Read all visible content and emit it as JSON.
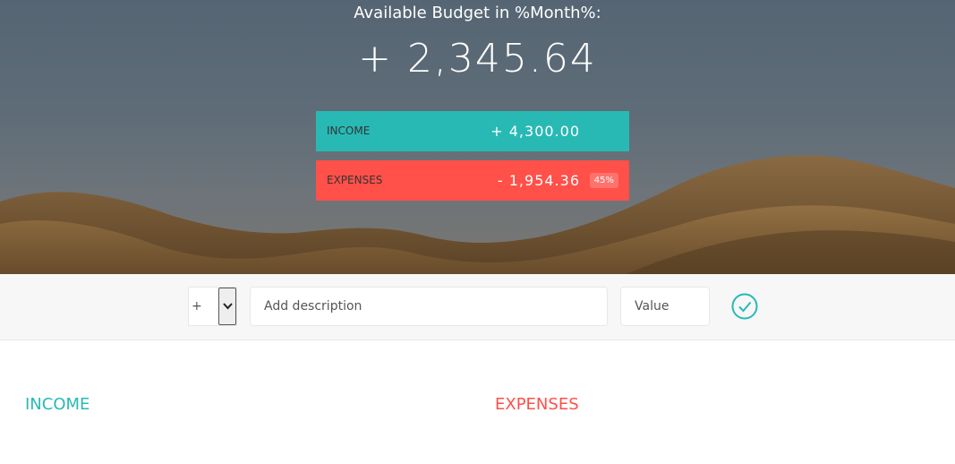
{
  "budget": {
    "title": "Available Budget in %Month%:",
    "value": "+ 2,345.64"
  },
  "income_panel": {
    "label": "INCOME",
    "value": "+ 4,300.00"
  },
  "expenses_panel": {
    "label": "EXPENSES",
    "value": "- 1,954.36",
    "percentage": "45%"
  },
  "add_form": {
    "type_selected": "+",
    "description_placeholder": "Add description",
    "value_placeholder": "Value",
    "submit_icon": "checkmark-circle-icon"
  },
  "lists": {
    "income_title": "INCOME",
    "expenses_title": "EXPENSES"
  },
  "colors": {
    "income": "#28b9b5",
    "expenses": "#ff5049"
  }
}
